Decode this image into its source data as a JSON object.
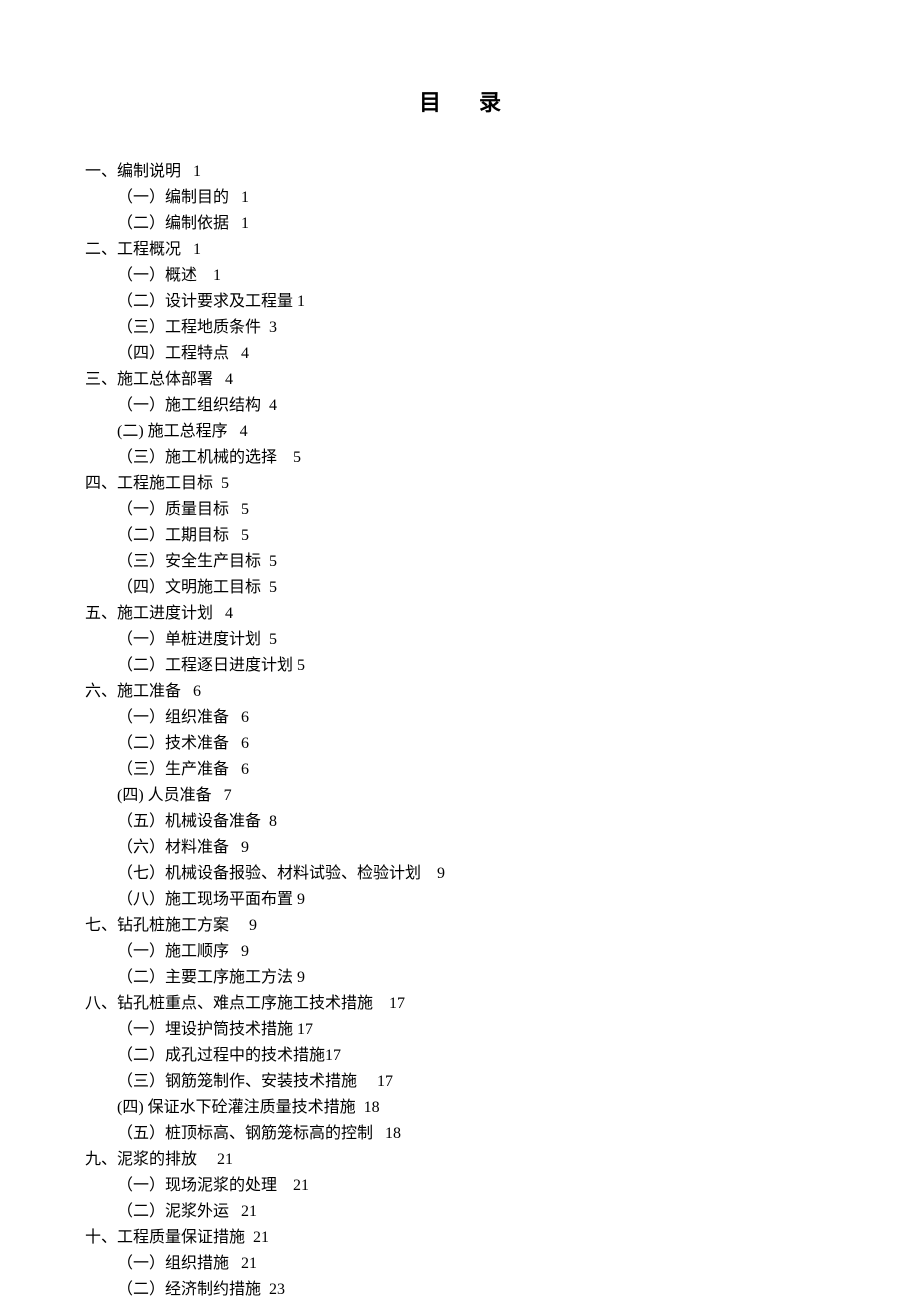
{
  "title": "目录",
  "entries": [
    {
      "indent": "l0",
      "text": "一、编制说明   1"
    },
    {
      "indent": "l1",
      "text": "（一）编制目的   1"
    },
    {
      "indent": "l1",
      "text": "（二）编制依据   1"
    },
    {
      "indent": "l0",
      "text": "二、工程概况   1"
    },
    {
      "indent": "l1",
      "text": "（一）概述    1"
    },
    {
      "indent": "l1",
      "text": "（二）设计要求及工程量 1"
    },
    {
      "indent": "l1",
      "text": "（三）工程地质条件  3"
    },
    {
      "indent": "l1",
      "text": "（四）工程特点   4"
    },
    {
      "indent": "l0",
      "text": "三、施工总体部署   4"
    },
    {
      "indent": "l1",
      "text": "（一）施工组织结构  4"
    },
    {
      "indent": "l1b",
      "text": " (二) 施工总程序   4"
    },
    {
      "indent": "l1",
      "text": "（三）施工机械的选择    5"
    },
    {
      "indent": "l0",
      "text": "四、工程施工目标  5"
    },
    {
      "indent": "l1",
      "text": "（一）质量目标   5"
    },
    {
      "indent": "l1",
      "text": "（二）工期目标   5"
    },
    {
      "indent": "l1",
      "text": "（三）安全生产目标  5"
    },
    {
      "indent": "l1",
      "text": "（四）文明施工目标  5"
    },
    {
      "indent": "l0",
      "text": "五、施工进度计划   4"
    },
    {
      "indent": "l1",
      "text": "（一）单桩进度计划  5"
    },
    {
      "indent": "l1",
      "text": "（二）工程逐日进度计划 5"
    },
    {
      "indent": "l0",
      "text": "六、施工准备   6"
    },
    {
      "indent": "l1",
      "text": "（一）组织准备   6"
    },
    {
      "indent": "l1",
      "text": "（二）技术准备   6"
    },
    {
      "indent": "l1",
      "text": "（三）生产准备   6"
    },
    {
      "indent": "l1b",
      "text": " (四) 人员准备   7"
    },
    {
      "indent": "l1",
      "text": "（五）机械设备准备  8"
    },
    {
      "indent": "l1",
      "text": "（六）材料准备   9"
    },
    {
      "indent": "l1",
      "text": "（七）机械设备报验、材料试验、检验计划    9"
    },
    {
      "indent": "l1",
      "text": "（八）施工现场平面布置 9"
    },
    {
      "indent": "l0",
      "text": "七、钻孔桩施工方案     9"
    },
    {
      "indent": "l1",
      "text": "（一）施工顺序   9"
    },
    {
      "indent": "l1",
      "text": "（二）主要工序施工方法 9"
    },
    {
      "indent": "l0",
      "text": "八、钻孔桩重点、难点工序施工技术措施    17"
    },
    {
      "indent": "l1",
      "text": "（一）埋设护筒技术措施 17"
    },
    {
      "indent": "l1",
      "text": "（二）成孔过程中的技术措施17"
    },
    {
      "indent": "l1",
      "text": "（三）钢筋笼制作、安装技术措施     17"
    },
    {
      "indent": "l1b",
      "text": " (四) 保证水下砼灌注质量技术措施  18"
    },
    {
      "indent": "l1",
      "text": "（五）桩顶标高、钢筋笼标高的控制   18"
    },
    {
      "indent": "l0",
      "text": "九、泥浆的排放     21"
    },
    {
      "indent": "l1",
      "text": "（一）现场泥浆的处理    21"
    },
    {
      "indent": "l1",
      "text": "（二）泥浆外运   21"
    },
    {
      "indent": "l0",
      "text": "十、工程质量保证措施  21"
    },
    {
      "indent": "l1",
      "text": "（一）组织措施   21"
    },
    {
      "indent": "l1",
      "text": "（二）经济制约措施  23"
    }
  ]
}
